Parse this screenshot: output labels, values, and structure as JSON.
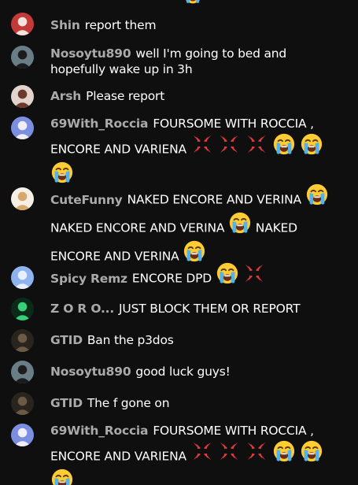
{
  "chat": {
    "messages": [
      {
        "author": "Shin",
        "text": "report them",
        "emojis": [],
        "avatar": {
          "bg": "#c23a3a",
          "fg": "#f3e4dc"
        }
      },
      {
        "author": "Nosoytu890",
        "text": "well I'm going to bed and hopefully wake up in 3h",
        "emojis": [],
        "avatar": {
          "bg": "#6a7d86",
          "fg": "#1c1c1c"
        }
      },
      {
        "author": "Arsh",
        "text": "Please report",
        "emojis": [],
        "avatar": {
          "bg": "#e2d4cc",
          "fg": "#6a3a2a"
        }
      },
      {
        "author": "69With_Roccia",
        "text": "FOURSOME WITH ROCCIA , ENCORE AND VARIENA",
        "emojis": [
          "anger-symbol-icon",
          "anger-symbol-icon",
          "anger-symbol-icon",
          "loudly-crying-face-icon",
          "loudly-crying-face-icon",
          "loudly-crying-face-icon"
        ],
        "avatar": {
          "bg": "#7c8ee0",
          "fg": "#f0eefb"
        }
      },
      {
        "author": "CuteFunny",
        "text1": "NAKED ENCORE AND VERINA",
        "text2": "NAKED ENCORE AND VERINA",
        "text3": "NAKED ENCORE AND VERINA",
        "emojis": [
          "loudly-crying-face-icon",
          "loudly-crying-face-icon",
          "loudly-crying-face-icon"
        ],
        "avatar": {
          "bg": "#f6efe6",
          "fg": "#d8a86a"
        }
      },
      {
        "author": "Spicy Remz",
        "text": "ENCORE DPD",
        "emojis": [
          "loudly-crying-face-icon",
          "anger-symbol-icon"
        ],
        "avatar": {
          "bg": "#8fb3ee",
          "fg": "#e8f0ff"
        }
      },
      {
        "author": "Z O R O...",
        "text": "JUST BLOCK THEM OR REPORT",
        "emojis": [],
        "avatar": {
          "bg": "#0c2a18",
          "fg": "#34d07a"
        }
      },
      {
        "author": "GTID",
        "text": "Ban the p3dos",
        "emojis": [],
        "avatar": {
          "bg": "#2a241e",
          "fg": "#6b5a44"
        }
      },
      {
        "author": "Nosoytu890",
        "text": "good luck guys!",
        "emojis": [],
        "avatar": {
          "bg": "#6a7d86",
          "fg": "#1c1c1c"
        }
      },
      {
        "author": "GTID",
        "text": "The f gone on",
        "emojis": [],
        "avatar": {
          "bg": "#2a241e",
          "fg": "#6b5a44"
        }
      },
      {
        "author": "69With_Roccia",
        "text": "FOURSOME WITH ROCCIA , ENCORE AND VARIENA",
        "emojis": [
          "anger-symbol-icon",
          "anger-symbol-icon",
          "anger-symbol-icon",
          "loudly-crying-face-icon",
          "loudly-crying-face-icon",
          "loudly-crying-face-icon"
        ],
        "avatar": {
          "bg": "#7c8ee0",
          "fg": "#f0eefb"
        }
      }
    ]
  }
}
